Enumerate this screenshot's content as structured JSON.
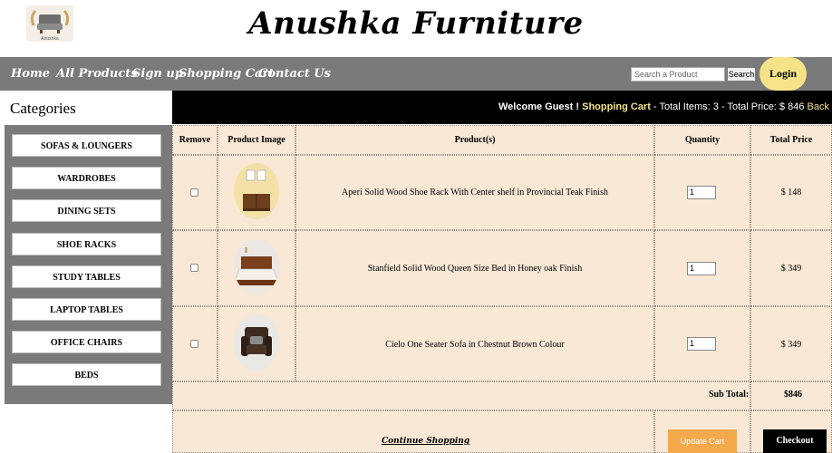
{
  "brand": {
    "logo_text": "Anushka",
    "title": "Anushka Furniture"
  },
  "nav": {
    "items": [
      "Home",
      "All Products",
      "Sign up",
      "Shopping Cart",
      "Contact Us"
    ],
    "search_placeholder": "Search a Product",
    "search_button": "Search",
    "login": "Login"
  },
  "sidebar": {
    "heading": "Categories",
    "items": [
      "SOFAS & LOUNGERS",
      "WARDROBES",
      "DINING SETS",
      "SHOE RACKS",
      "STUDY TABLES",
      "LAPTOP TABLES",
      "OFFICE CHAIRS",
      "BEDS"
    ]
  },
  "welcome": {
    "prefix": "Welcome Guest ! ",
    "cart_link": "Shopping Cart",
    "summary": " - Total Items: 3 - Total Price: $ 846 ",
    "back_link": "Back to Shopping"
  },
  "cart": {
    "headers": [
      "Remove",
      "Product Image",
      "Product(s)",
      "Quantity",
      "Total Price"
    ],
    "rows": [
      {
        "name": "Aperi Solid Wood Shoe Rack With Center shelf in Provincial Teak Finish",
        "quantity": "1",
        "price": "$ 148",
        "icon": "shoe-rack-icon"
      },
      {
        "name": "Stanfield Solid Wood Queen Size Bed in Honey oak Finish",
        "quantity": "1",
        "price": "$ 349",
        "icon": "bed-icon"
      },
      {
        "name": "Cielo One Seater Sofa in Chestnut Brown Colour",
        "quantity": "1",
        "price": "$ 349",
        "icon": "sofa-icon"
      }
    ],
    "sub_total_label": "Sub Total:",
    "sub_total_value": "$846",
    "continue_shopping": "Continue Shopping",
    "update_cart": "Update Cart",
    "checkout": "Checkout"
  },
  "colors": {
    "nav_bg": "#7a7a7a",
    "accent_yellow": "#f6e389",
    "table_bg": "#f8e8d5",
    "update_btn": "#f4a94a"
  }
}
